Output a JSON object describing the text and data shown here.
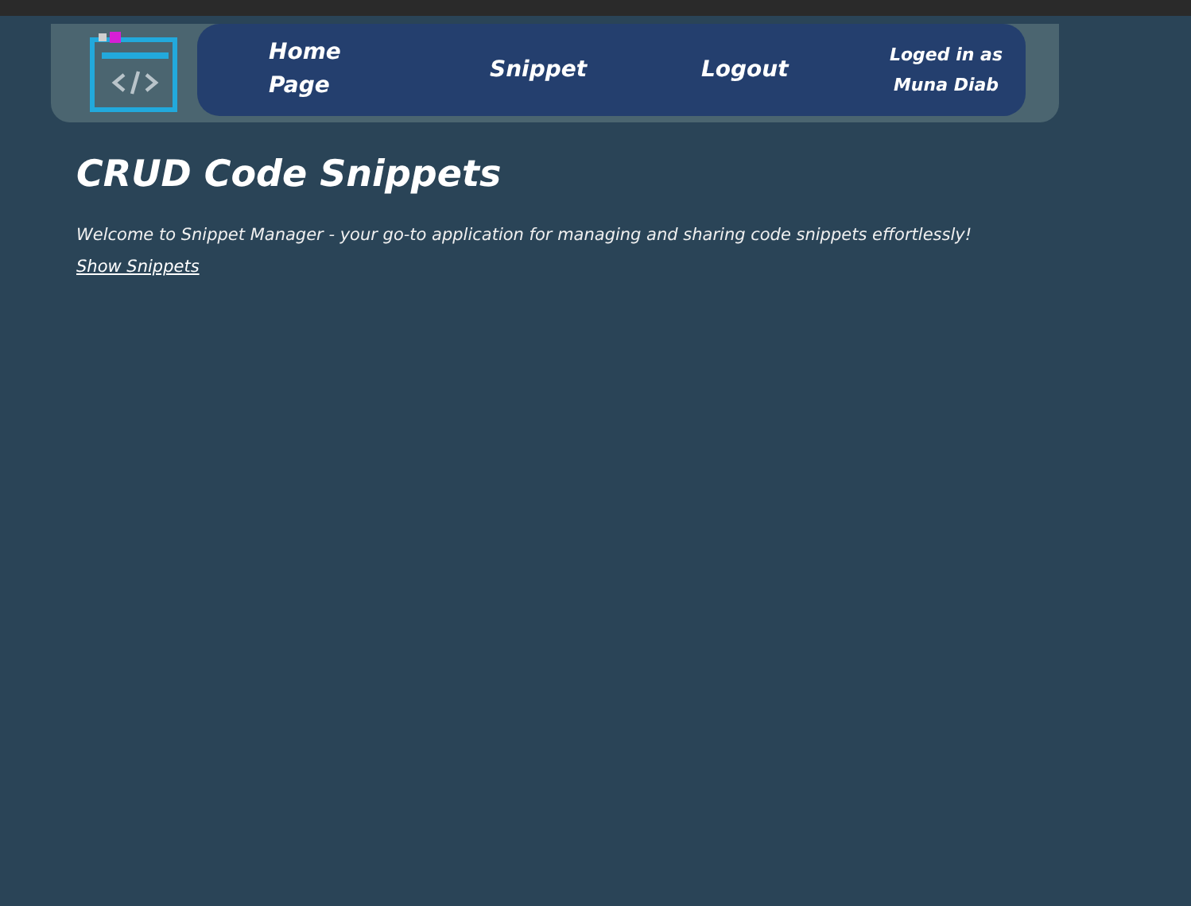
{
  "nav": {
    "items": [
      {
        "label": "Home Page"
      },
      {
        "label": "Snippet"
      },
      {
        "label": "Logout"
      }
    ],
    "user": "Loged in as Muna Diab"
  },
  "page": {
    "title": "CRUD Code Snippets",
    "intro": "Welcome to Snippet Manager - your go-to application for managing and sharing code snippets effortlessly!",
    "link": "Show Snippets"
  }
}
